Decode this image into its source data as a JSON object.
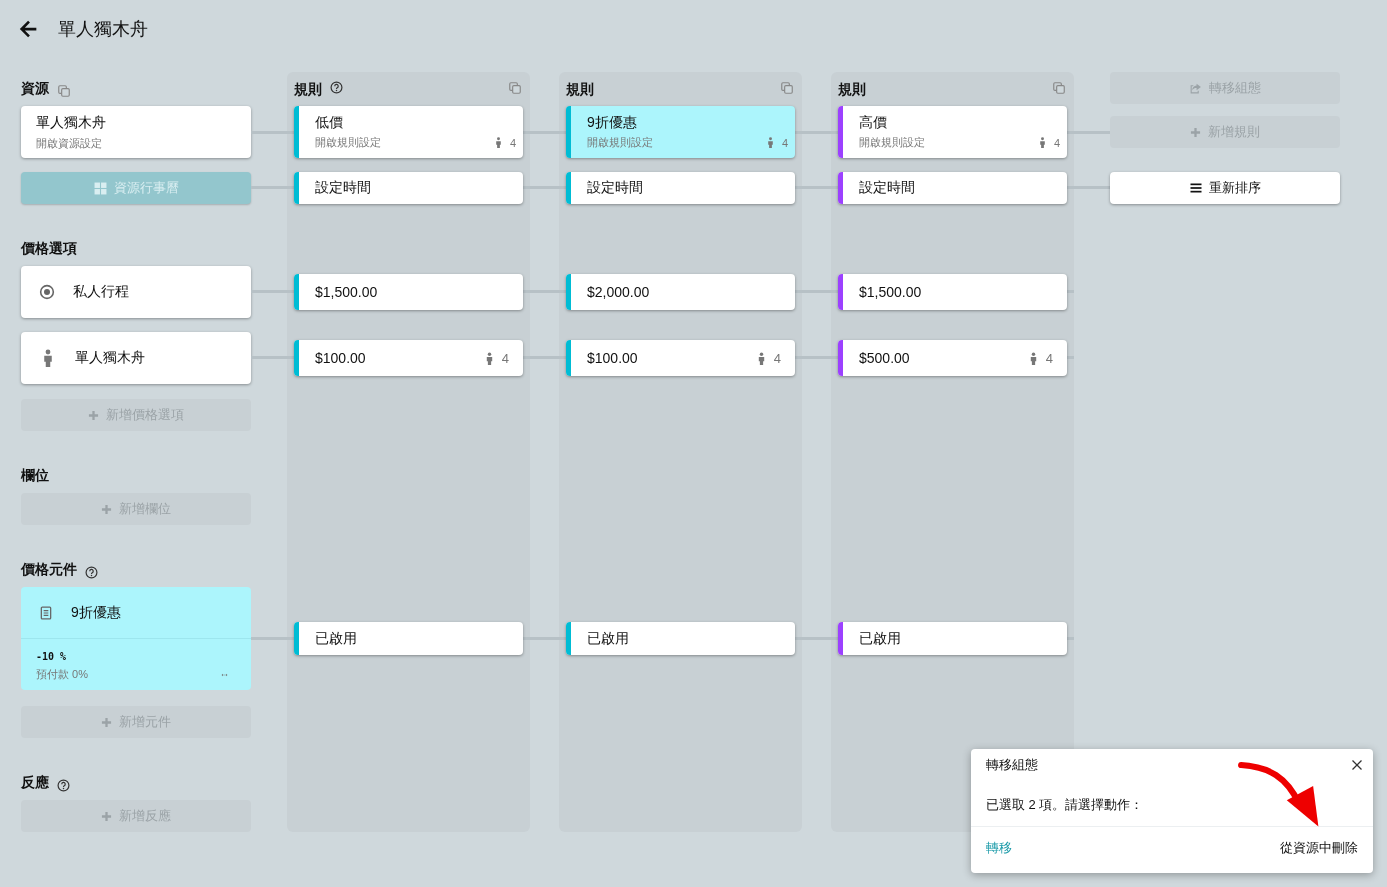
{
  "page": {
    "title": "單人獨木舟"
  },
  "resource": {
    "title": "資源",
    "card": {
      "name": "單人獨木舟",
      "subtitle": "開啟資源設定"
    },
    "calendar_button": {
      "label": "資源行事曆",
      "disabled": true
    }
  },
  "price_options": {
    "title": "價格選項",
    "items": [
      {
        "kind": "private",
        "label": "私人行程"
      },
      {
        "kind": "person",
        "label": "單人獨木舟"
      }
    ],
    "add_button": {
      "label": "新增價格選項",
      "disabled": true
    }
  },
  "slots": {
    "title": "欄位",
    "add_button": {
      "label": "新增欄位",
      "disabled": true
    }
  },
  "price_components": {
    "title": "價格元件",
    "help": true,
    "items": [
      {
        "name": "9折優惠",
        "value": "-10 %",
        "prepayment": "預付款 0%",
        "selected": true
      }
    ],
    "add_button": {
      "label": "新增元件",
      "disabled": true
    }
  },
  "reactions": {
    "title": "反應",
    "help": true,
    "add_button": {
      "label": "新增反應",
      "disabled": true
    }
  },
  "rules": [
    {
      "title": "規則",
      "help": true,
      "name": "低價",
      "subtitle": "開啟規則設定",
      "count": "4",
      "color": "#00bcd4",
      "selected": false,
      "time_label": "設定時間",
      "prices": [
        {
          "amount": "$1,500.00"
        },
        {
          "amount": "$100.00",
          "count": "4"
        }
      ],
      "component_status": "已啟用"
    },
    {
      "title": "規則",
      "help": false,
      "name": "9折優惠",
      "subtitle": "開啟規則設定",
      "count": "4",
      "color": "#00bcd4",
      "selected": true,
      "time_label": "設定時間",
      "prices": [
        {
          "amount": "$2,000.00"
        },
        {
          "amount": "$100.00",
          "count": "4"
        }
      ],
      "component_status": "已啟用"
    },
    {
      "title": "規則",
      "help": false,
      "name": "高價",
      "subtitle": "開啟規則設定",
      "count": "4",
      "color": "#9c40ff",
      "selected": false,
      "time_label": "設定時間",
      "prices": [
        {
          "amount": "$1,500.00"
        },
        {
          "amount": "$500.00",
          "count": "4"
        }
      ],
      "component_status": "已啟用"
    }
  ],
  "rule_actions": [
    {
      "kind": "transfer",
      "label": "轉移組態",
      "disabled": true
    },
    {
      "kind": "add",
      "label": "新增規則",
      "disabled": true
    }
  ],
  "reorder_button": {
    "label": "重新排序",
    "disabled": false
  },
  "dialog": {
    "title": "轉移組態",
    "message": "已選取 2 項。請選擇動作：",
    "actions": [
      {
        "kind": "primary",
        "label": "轉移"
      },
      {
        "kind": "plain",
        "label": "從資源中刪除"
      }
    ]
  }
}
